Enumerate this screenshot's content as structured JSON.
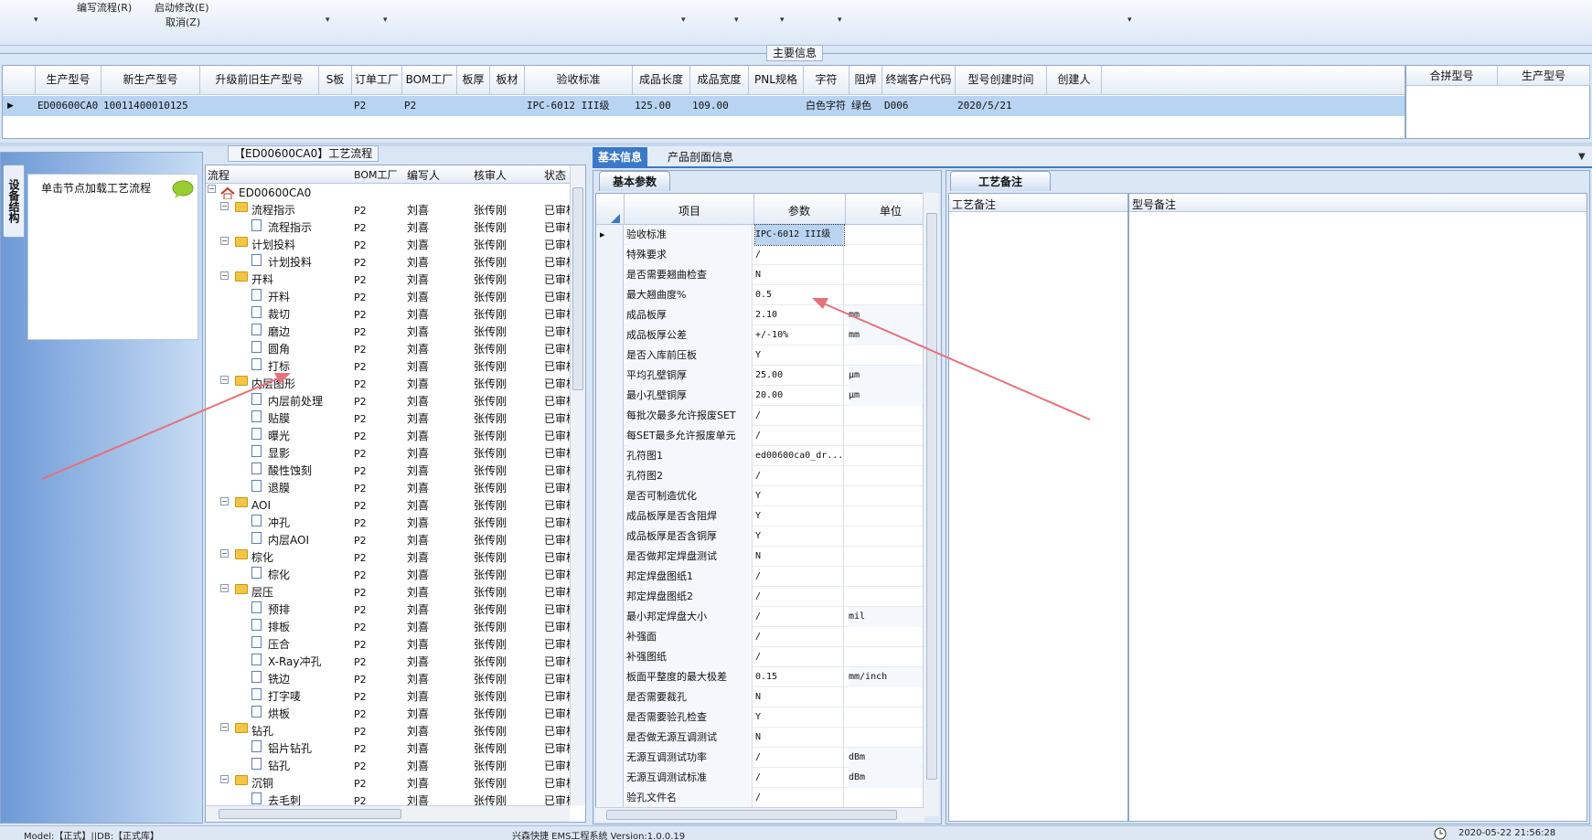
{
  "toolbar": {
    "items": [
      "编写流程(R)",
      "启动修改(E)",
      "取消(Z)"
    ]
  },
  "main_info": {
    "title": "主要信息",
    "columns": [
      "生产型号",
      "新生产型号",
      "升级前旧生产型号",
      "S板",
      "订单工厂",
      "BOM工厂",
      "板厚",
      "板材",
      "验收标准",
      "成品长度",
      "成品宽度",
      "PNL规格",
      "字符",
      "阻焊",
      "终端客户代码",
      "型号创建时间",
      "创建人"
    ],
    "row": [
      "ED00600CA0",
      "10011400010125",
      "",
      "",
      "P2",
      "P2",
      "",
      "",
      "IPC-6012 III级",
      "125.00",
      "109.00",
      "",
      "白色字符",
      "绿色",
      "D006",
      "2020/5/21",
      ""
    ],
    "right_columns": [
      "合拼型号",
      "生产型号"
    ]
  },
  "left_panel": {
    "side_tab": "设备结构",
    "hint": "单击节点加载工艺流程"
  },
  "flow": {
    "title": "【ED00600CA0】工艺流程",
    "columns": [
      "流程",
      "BOM工厂",
      "编写人",
      "核审人",
      "状态"
    ],
    "rows": [
      {
        "name": "ED00600CA0",
        "level": 0,
        "type": "root",
        "factory": "",
        "writer": "",
        "reviewer": "",
        "status": ""
      },
      {
        "name": "流程指示",
        "level": 1,
        "type": "folder",
        "factory": "P2",
        "writer": "刘喜",
        "reviewer": "张传刚",
        "status": "已审核"
      },
      {
        "name": "流程指示",
        "level": 2,
        "type": "doc",
        "factory": "P2",
        "writer": "刘喜",
        "reviewer": "张传刚",
        "status": "已审核"
      },
      {
        "name": "计划投料",
        "level": 1,
        "type": "folder",
        "factory": "P2",
        "writer": "刘喜",
        "reviewer": "张传刚",
        "status": "已审核"
      },
      {
        "name": "计划投料",
        "level": 2,
        "type": "doc",
        "factory": "P2",
        "writer": "刘喜",
        "reviewer": "张传刚",
        "status": "已审核"
      },
      {
        "name": "开料",
        "level": 1,
        "type": "folder",
        "factory": "P2",
        "writer": "刘喜",
        "reviewer": "张传刚",
        "status": "已审核"
      },
      {
        "name": "开料",
        "level": 2,
        "type": "doc",
        "factory": "P2",
        "writer": "刘喜",
        "reviewer": "张传刚",
        "status": "已审核"
      },
      {
        "name": "裁切",
        "level": 2,
        "type": "doc",
        "factory": "P2",
        "writer": "刘喜",
        "reviewer": "张传刚",
        "status": "已审核"
      },
      {
        "name": "磨边",
        "level": 2,
        "type": "doc",
        "factory": "P2",
        "writer": "刘喜",
        "reviewer": "张传刚",
        "status": "已审核"
      },
      {
        "name": "圆角",
        "level": 2,
        "type": "doc",
        "factory": "P2",
        "writer": "刘喜",
        "reviewer": "张传刚",
        "status": "已审核"
      },
      {
        "name": "打标",
        "level": 2,
        "type": "doc",
        "factory": "P2",
        "writer": "刘喜",
        "reviewer": "张传刚",
        "status": "已审核"
      },
      {
        "name": "内层图形",
        "level": 1,
        "type": "folder",
        "factory": "P2",
        "writer": "刘喜",
        "reviewer": "张传刚",
        "status": "已审核"
      },
      {
        "name": "内层前处理",
        "level": 2,
        "type": "doc",
        "factory": "P2",
        "writer": "刘喜",
        "reviewer": "张传刚",
        "status": "已审核"
      },
      {
        "name": "贴膜",
        "level": 2,
        "type": "doc",
        "factory": "P2",
        "writer": "刘喜",
        "reviewer": "张传刚",
        "status": "已审核"
      },
      {
        "name": "曝光",
        "level": 2,
        "type": "doc",
        "factory": "P2",
        "writer": "刘喜",
        "reviewer": "张传刚",
        "status": "已审核"
      },
      {
        "name": "显影",
        "level": 2,
        "type": "doc",
        "factory": "P2",
        "writer": "刘喜",
        "reviewer": "张传刚",
        "status": "已审核"
      },
      {
        "name": "酸性蚀刻",
        "level": 2,
        "type": "doc",
        "factory": "P2",
        "writer": "刘喜",
        "reviewer": "张传刚",
        "status": "已审核"
      },
      {
        "name": "退膜",
        "level": 2,
        "type": "doc",
        "factory": "P2",
        "writer": "刘喜",
        "reviewer": "张传刚",
        "status": "已审核"
      },
      {
        "name": "AOI",
        "level": 1,
        "type": "folder",
        "factory": "P2",
        "writer": "刘喜",
        "reviewer": "张传刚",
        "status": "已审核"
      },
      {
        "name": "冲孔",
        "level": 2,
        "type": "doc",
        "factory": "P2",
        "writer": "刘喜",
        "reviewer": "张传刚",
        "status": "已审核"
      },
      {
        "name": "内层AOI",
        "level": 2,
        "type": "doc",
        "factory": "P2",
        "writer": "刘喜",
        "reviewer": "张传刚",
        "status": "已审核"
      },
      {
        "name": "棕化",
        "level": 1,
        "type": "folder",
        "factory": "P2",
        "writer": "刘喜",
        "reviewer": "张传刚",
        "status": "已审核"
      },
      {
        "name": "棕化",
        "level": 2,
        "type": "doc",
        "factory": "P2",
        "writer": "刘喜",
        "reviewer": "张传刚",
        "status": "已审核"
      },
      {
        "name": "层压",
        "level": 1,
        "type": "folder",
        "factory": "P2",
        "writer": "刘喜",
        "reviewer": "张传刚",
        "status": "已审核"
      },
      {
        "name": "预排",
        "level": 2,
        "type": "doc",
        "factory": "P2",
        "writer": "刘喜",
        "reviewer": "张传刚",
        "status": "已审核"
      },
      {
        "name": "排板",
        "level": 2,
        "type": "doc",
        "factory": "P2",
        "writer": "刘喜",
        "reviewer": "张传刚",
        "status": "已审核"
      },
      {
        "name": "压合",
        "level": 2,
        "type": "doc",
        "factory": "P2",
        "writer": "刘喜",
        "reviewer": "张传刚",
        "status": "已审核"
      },
      {
        "name": "X-Ray冲孔",
        "level": 2,
        "type": "doc",
        "factory": "P2",
        "writer": "刘喜",
        "reviewer": "张传刚",
        "status": "已审核"
      },
      {
        "name": "铣边",
        "level": 2,
        "type": "doc",
        "factory": "P2",
        "writer": "刘喜",
        "reviewer": "张传刚",
        "status": "已审核"
      },
      {
        "name": "打字唛",
        "level": 2,
        "type": "doc",
        "factory": "P2",
        "writer": "刘喜",
        "reviewer": "张传刚",
        "status": "已审核"
      },
      {
        "name": "烘板",
        "level": 2,
        "type": "doc",
        "factory": "P2",
        "writer": "刘喜",
        "reviewer": "张传刚",
        "status": "已审核"
      },
      {
        "name": "钻孔",
        "level": 1,
        "type": "folder",
        "factory": "P2",
        "writer": "刘喜",
        "reviewer": "张传刚",
        "status": "已审核"
      },
      {
        "name": "铝片钻孔",
        "level": 2,
        "type": "doc",
        "factory": "P2",
        "writer": "刘喜",
        "reviewer": "张传刚",
        "status": "已审核"
      },
      {
        "name": "钻孔",
        "level": 2,
        "type": "doc",
        "factory": "P2",
        "writer": "刘喜",
        "reviewer": "张传刚",
        "status": "已审核"
      },
      {
        "name": "沉铜",
        "level": 1,
        "type": "folder",
        "factory": "P2",
        "writer": "刘喜",
        "reviewer": "张传刚",
        "status": "已审核"
      },
      {
        "name": "去毛刺",
        "level": 2,
        "type": "doc",
        "factory": "P2",
        "writer": "刘喜",
        "reviewer": "张传刚",
        "status": "已审核"
      }
    ]
  },
  "tabs": {
    "basic_info": "基本信息",
    "profile_info": "产品剖面信息",
    "basic_params": "基本参数",
    "process_notes": "工艺备注"
  },
  "params": {
    "columns": [
      "项目",
      "参数",
      "单位"
    ],
    "rows": [
      {
        "item": "验收标准",
        "value": "IPC-6012 III级",
        "unit": ""
      },
      {
        "item": "特殊要求",
        "value": "/",
        "unit": ""
      },
      {
        "item": "是否需要翘曲检查",
        "value": "N",
        "unit": ""
      },
      {
        "item": "最大翘曲度%",
        "value": "0.5",
        "unit": ""
      },
      {
        "item": "成品板厚",
        "value": "2.10",
        "unit": "mm"
      },
      {
        "item": "成品板厚公差",
        "value": "+/-10%",
        "unit": "mm"
      },
      {
        "item": "是否入库前压板",
        "value": "Y",
        "unit": ""
      },
      {
        "item": "平均孔壁铜厚",
        "value": "25.00",
        "unit": "μm"
      },
      {
        "item": "最小孔壁铜厚",
        "value": "20.00",
        "unit": "μm"
      },
      {
        "item": "每批次最多允许报废SET",
        "value": "/",
        "unit": ""
      },
      {
        "item": "每SET最多允许报废单元",
        "value": "/",
        "unit": ""
      },
      {
        "item": "孔符图1",
        "value": "ed00600ca0_dr...",
        "unit": ""
      },
      {
        "item": "孔符图2",
        "value": "/",
        "unit": ""
      },
      {
        "item": "是否可制造优化",
        "value": "Y",
        "unit": ""
      },
      {
        "item": "成品板厚是否含阻焊",
        "value": "Y",
        "unit": ""
      },
      {
        "item": "成品板厚是否含铜厚",
        "value": "Y",
        "unit": ""
      },
      {
        "item": "是否做邦定焊盘测试",
        "value": "N",
        "unit": ""
      },
      {
        "item": "邦定焊盘图纸1",
        "value": "/",
        "unit": ""
      },
      {
        "item": "邦定焊盘图纸2",
        "value": "/",
        "unit": ""
      },
      {
        "item": "最小邦定焊盘大小",
        "value": "/",
        "unit": "mil"
      },
      {
        "item": "补强面",
        "value": "/",
        "unit": ""
      },
      {
        "item": "补强图纸",
        "value": "/",
        "unit": ""
      },
      {
        "item": "板面平整度的最大极差",
        "value": "0.15",
        "unit": "mm/inch"
      },
      {
        "item": "是否需要裁孔",
        "value": "N",
        "unit": ""
      },
      {
        "item": "是否需要验孔检查",
        "value": "Y",
        "unit": ""
      },
      {
        "item": "是否做无源互调测试",
        "value": "N",
        "unit": ""
      },
      {
        "item": "无源互调测试功率",
        "value": "/",
        "unit": "dBm"
      },
      {
        "item": "无源互调测试标准",
        "value": "/",
        "unit": "dBm"
      },
      {
        "item": "验孔文件名",
        "value": "/",
        "unit": ""
      }
    ]
  },
  "notes": {
    "columns": [
      "工艺备注",
      "型号备注"
    ]
  },
  "status_bar": {
    "left": "Model:【正式】||DB:【正式库】",
    "center": "兴森快捷 EMS工程系统 Version:1.0.0.19",
    "right": "2020-05-22 21:56:28"
  },
  "colors": {
    "accent": "#3b78c7",
    "selection": "#b9d4f2",
    "annotation_arrow": "#e8707a"
  }
}
